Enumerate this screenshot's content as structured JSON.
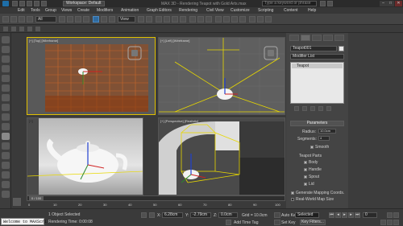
{
  "titlebar": {
    "workspace": "Workspace: Default",
    "title": "MAX 3D - Rendering Teapot with Gold Arts.max",
    "search_placeholder": "Type a keyword or phrase",
    "minimize": "–",
    "maximize": "□",
    "close": "✕"
  },
  "menubar": {
    "items": [
      "Edit",
      "Tools",
      "Group",
      "Views",
      "Create",
      "Modifiers",
      "Animation",
      "Graph Editors",
      "Rendering",
      "Civil View",
      "Customize",
      "Scripting",
      "Content",
      "Help"
    ]
  },
  "toolbar": {
    "selection_filter": "All",
    "reference_coord": "View"
  },
  "viewports": {
    "top": {
      "label": "[+] [Top] [Wireframe]"
    },
    "left": {
      "label": "[+] [Left] [Wireframe]"
    },
    "front": {
      "label": "[+]"
    },
    "persp": {
      "label": "[+] [Perspective] [Realistic]"
    }
  },
  "command_panel": {
    "object_name": "Teapot001",
    "modifier_list": "Modifier List",
    "stack_item": "Teapot",
    "parameters_title": "Parameters",
    "radius_label": "Radius:",
    "radius_value": "10.0cm",
    "segments_label": "Segments:",
    "segments_value": "4",
    "smooth_label": "Smooth",
    "teapot_parts_label": "Teapot Parts",
    "parts": [
      "Body",
      "Handle",
      "Spout",
      "Lid"
    ],
    "gen_mapping": "Generate Mapping Coords.",
    "real_world": "Real-World Map Size",
    "color_swatch": "#e8e8e8"
  },
  "timeline": {
    "frame_range": "0 / 100",
    "ticks": [
      "0",
      "10",
      "20",
      "30",
      "40",
      "50",
      "60",
      "70",
      "80",
      "90",
      "100"
    ]
  },
  "status": {
    "listener_text": "Welcome to MAXScri",
    "selection_text": "1 Object Selected",
    "prompt_text": "Rendering Time: 0:00:08",
    "x_label": "X:",
    "x_value": "6.28cm",
    "y_label": "Y:",
    "y_value": "-2.79cm",
    "z_label": "Z:",
    "z_value": "0.0cm",
    "grid": "Grid = 10.0cm",
    "add_time_tag": "Add Time Tag",
    "auto_key": "Auto Key",
    "set_key": "Set Key",
    "selected_dropdown": "Selected",
    "key_filters": "Key Filters...",
    "frame_value": "0"
  },
  "colors": {
    "accent_blue": "#2f6ba0",
    "orange_grid": "#c05820",
    "yellow_wire": "#e8d800",
    "teapot_white": "#f4f4f4"
  }
}
